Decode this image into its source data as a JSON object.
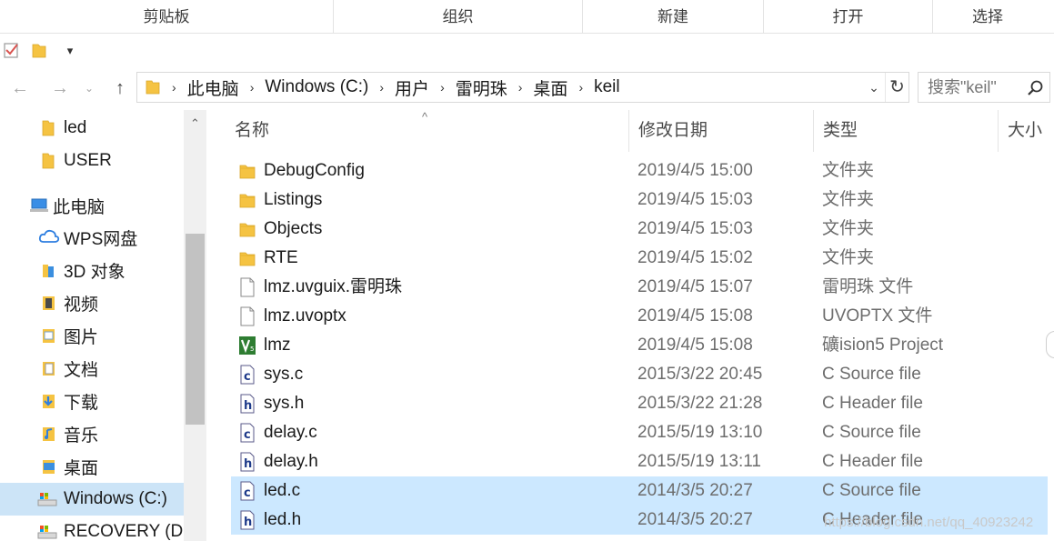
{
  "ribbon": {
    "groups": [
      "剪贴板",
      "组织",
      "新建",
      "打开",
      "选择"
    ]
  },
  "quick_access": {
    "dropdown_symbol": "▾"
  },
  "address_bar": {
    "breadcrumbs": [
      "此电脑",
      "Windows (C:)",
      "用户",
      "雷明珠",
      "桌面",
      "keil"
    ],
    "separator": "›"
  },
  "search": {
    "placeholder": "搜索\"keil\""
  },
  "nav_pane": {
    "items": [
      {
        "label": "led",
        "icon": "folder-icon"
      },
      {
        "label": "USER",
        "icon": "folder-icon"
      },
      {
        "label": "此电脑",
        "icon": "computer-icon"
      },
      {
        "label": "WPS网盘",
        "icon": "cloud-icon"
      },
      {
        "label": "3D 对象",
        "icon": "3d-objects-icon"
      },
      {
        "label": "视频",
        "icon": "video-icon"
      },
      {
        "label": "图片",
        "icon": "pictures-icon"
      },
      {
        "label": "文档",
        "icon": "documents-icon"
      },
      {
        "label": "下载",
        "icon": "downloads-icon"
      },
      {
        "label": "音乐",
        "icon": "music-icon"
      },
      {
        "label": "桌面",
        "icon": "desktop-icon"
      },
      {
        "label": "Windows (C:)",
        "icon": "drive-icon"
      },
      {
        "label": "RECOVERY (D:)",
        "icon": "drive-icon"
      }
    ],
    "selected": "Windows (C:)"
  },
  "file_list": {
    "columns": {
      "name": "名称",
      "date": "修改日期",
      "type": "类型",
      "size": "大小"
    },
    "sort_indicator": "^",
    "rows": [
      {
        "name": "DebugConfig",
        "date": "2019/4/5 15:00",
        "type": "文件夹",
        "icon": "folder-icon"
      },
      {
        "name": "Listings",
        "date": "2019/4/5 15:03",
        "type": "文件夹",
        "icon": "folder-icon"
      },
      {
        "name": "Objects",
        "date": "2019/4/5 15:03",
        "type": "文件夹",
        "icon": "folder-icon"
      },
      {
        "name": "RTE",
        "date": "2019/4/5 15:02",
        "type": "文件夹",
        "icon": "folder-icon"
      },
      {
        "name": "lmz.uvguix.雷明珠",
        "date": "2019/4/5 15:07",
        "type": "雷明珠 文件",
        "icon": "blank-file-icon"
      },
      {
        "name": "lmz.uvoptx",
        "date": "2019/4/5 15:08",
        "type": "UVOPTX 文件",
        "icon": "blank-file-icon"
      },
      {
        "name": "lmz",
        "date": "2019/4/5 15:08",
        "type": "礦ision5 Project",
        "icon": "keil-project-icon"
      },
      {
        "name": "sys.c",
        "date": "2015/3/22 20:45",
        "type": "C Source file",
        "icon": "c-source-file-icon"
      },
      {
        "name": "sys.h",
        "date": "2015/3/22 21:28",
        "type": "C Header file",
        "icon": "c-header-file-icon"
      },
      {
        "name": "delay.c",
        "date": "2015/5/19 13:10",
        "type": "C Source file",
        "icon": "c-source-file-icon"
      },
      {
        "name": "delay.h",
        "date": "2015/5/19 13:11",
        "type": "C Header file",
        "icon": "c-header-file-icon"
      },
      {
        "name": "led.c",
        "date": "2014/3/5 20:27",
        "type": "C Source file",
        "icon": "c-source-file-icon",
        "selected": true
      },
      {
        "name": "led.h",
        "date": "2014/3/5 20:27",
        "type": "C Header file",
        "icon": "c-header-file-icon",
        "selected": true
      }
    ]
  },
  "watermark": "https://blog.csdn.net/qq_40923242",
  "colors": {
    "selection": "#cce8ff",
    "nav_selection": "#cce4f7",
    "folder": "#f5c342"
  }
}
